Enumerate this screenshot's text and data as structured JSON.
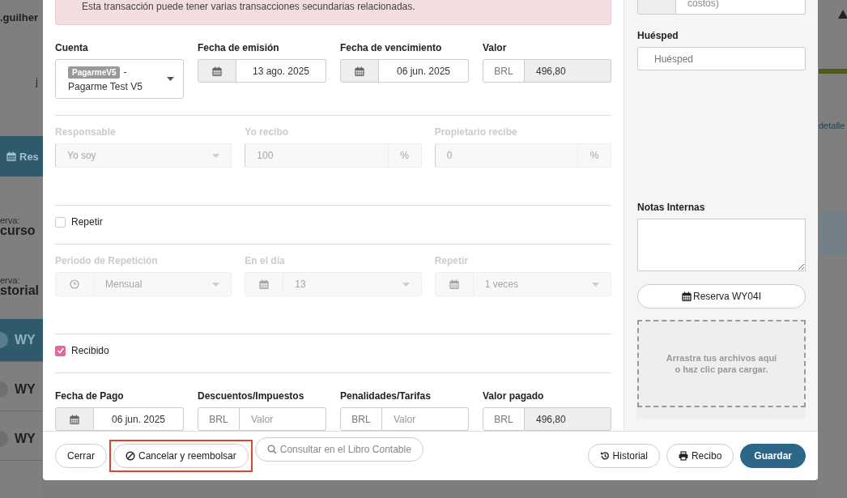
{
  "background": {
    "user": ".guilher",
    "fragment": "j",
    "reserve_button": "Res",
    "sections": [
      {
        "label": "erva:",
        "value": "curso"
      },
      {
        "label": "erva:",
        "value": "storial"
      }
    ],
    "list": [
      {
        "code": "WY",
        "selected": true
      },
      {
        "code": "WY",
        "selected": false
      },
      {
        "code": "WY",
        "selected": false
      }
    ],
    "right_link": "detalle"
  },
  "modal": {
    "alert": "Esta transacción puede tener varias transacciones secundarias relacionadas.",
    "sections": [
      {
        "kind": "fields",
        "disabled": false,
        "fields": [
          {
            "kind": "account",
            "label": "Cuenta",
            "badge": "PagarmeV5",
            "suffix": "-",
            "value": "Pagarme Test V5"
          },
          {
            "kind": "date",
            "label": "Fecha de emisión",
            "value": "13 ago. 2025"
          },
          {
            "kind": "date",
            "label": "Fecha de vencimiento",
            "value": "06 jun. 2025"
          },
          {
            "kind": "money",
            "label": "Valor",
            "addon": "BRL",
            "value": "496,80",
            "readonly": true
          }
        ]
      },
      {
        "kind": "fields",
        "disabled": true,
        "fields": [
          {
            "kind": "select",
            "label": "Responsable",
            "value": "Yo soy"
          },
          {
            "kind": "percent",
            "label": "Yo recibo",
            "value": "100",
            "addon": "%"
          },
          {
            "kind": "percent",
            "label": "Propietario recibe",
            "value": "0",
            "addon": "%"
          }
        ]
      },
      {
        "kind": "check",
        "label": "Repetir",
        "checked": false
      },
      {
        "kind": "fields",
        "disabled": true,
        "fields": [
          {
            "kind": "period",
            "label": "Periodo de Repetición",
            "value": "Mensual"
          },
          {
            "kind": "calendar-select",
            "label": "En el día",
            "value": "13"
          },
          {
            "kind": "calendar-select",
            "label": "Repetir",
            "value": "1 veces"
          }
        ]
      },
      {
        "kind": "check",
        "label": "Recibido",
        "checked": true
      },
      {
        "kind": "fields",
        "disabled": false,
        "fields": [
          {
            "kind": "date",
            "label": "Fecha de Pago",
            "value": "06 jun. 2025"
          },
          {
            "kind": "money",
            "label": "Descuentos/Impuestos",
            "addon": "BRL",
            "placeholder": "Valor",
            "readonly": false
          },
          {
            "kind": "money",
            "label": "Penalidades/Tarifas",
            "addon": "BRL",
            "placeholder": "Valor",
            "readonly": false
          },
          {
            "kind": "money",
            "label": "Valor pagado",
            "addon": "BRL",
            "value": "496,80",
            "readonly": true
          }
        ]
      }
    ],
    "sidebar": {
      "top_value": "costos)",
      "guest_label": "Huésped",
      "guest_placeholder": "Huésped",
      "notes_label": "Notas Internas",
      "reservation_button": "Reserva WY04I",
      "dropzone": [
        "Arrastra tus archivos aquí",
        "o haz clic para cargar."
      ]
    },
    "footer": {
      "left": [
        {
          "kind": "plain",
          "label": "Cerrar",
          "highlighted": false,
          "disabled": false
        },
        {
          "kind": "cancel",
          "label": "Cancelar y reembolsar",
          "highlighted": true,
          "disabled": false
        },
        {
          "kind": "search",
          "label": "Consultar en el Libro Contable",
          "highlighted": false,
          "disabled": true
        }
      ],
      "right": [
        {
          "kind": "history",
          "label": "Historial",
          "highlighted": false,
          "disabled": false
        },
        {
          "kind": "print",
          "label": "Recibo",
          "highlighted": false,
          "disabled": false
        },
        {
          "kind": "primary",
          "label": "Guardar",
          "highlighted": false,
          "disabled": false
        }
      ]
    }
  }
}
